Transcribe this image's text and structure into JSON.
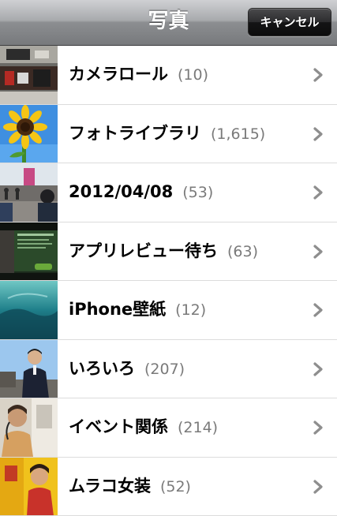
{
  "navbar": {
    "title": "写真",
    "cancel_label": "キャンセル"
  },
  "albums": [
    {
      "name": "カメラロール",
      "count": "(10)",
      "icon": "camera-roll-thumbnail"
    },
    {
      "name": "フォトライブラリ",
      "count": "(1,615)",
      "icon": "sunflower-thumbnail"
    },
    {
      "name": "2012/04/08",
      "count": "(53)",
      "icon": "street-thumbnail"
    },
    {
      "name": "アプリレビュー待ち",
      "count": "(63)",
      "icon": "app-screen-thumbnail"
    },
    {
      "name": "iPhone壁紙",
      "count": "(12)",
      "icon": "water-wallpaper-thumbnail"
    },
    {
      "name": "いろいろ",
      "count": "(207)",
      "icon": "person-thumbnail"
    },
    {
      "name": "イベント関係",
      "count": "(214)",
      "icon": "event-thumbnail"
    },
    {
      "name": "ムラコ女装",
      "count": "(52)",
      "icon": "yellow-room-thumbnail"
    }
  ],
  "colors": {
    "count_text": "#7a7a7a",
    "chevron": "#8e8e8e",
    "separator": "#dcdcdc"
  }
}
